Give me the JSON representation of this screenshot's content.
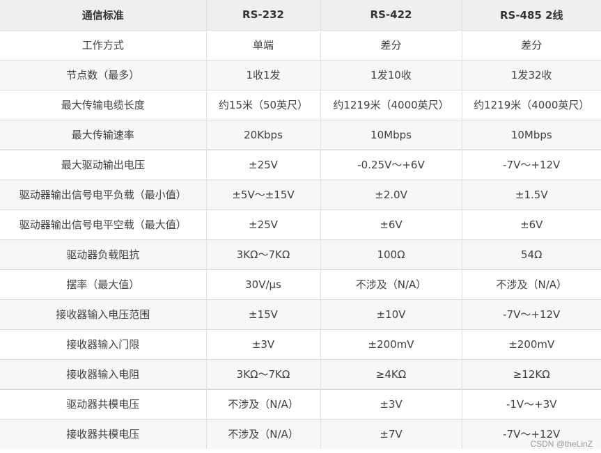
{
  "table": {
    "headers": [
      "通信标准",
      "RS-232",
      "RS-422",
      "RS-485 2线"
    ],
    "rows": [
      [
        "工作方式",
        "单端",
        "差分",
        "差分"
      ],
      [
        "节点数（最多）",
        "1收1发",
        "1发10收",
        "1发32收"
      ],
      [
        "最大传输电缆长度",
        "约15米（50英尺）",
        "约1219米（4000英尺）",
        "约1219米（4000英尺）"
      ],
      [
        "最大传输速率",
        "20Kbps",
        "10Mbps",
        "10Mbps"
      ],
      [
        "最大驱动输出电压",
        "±25V",
        "-0.25V～+6V",
        "-7V～+12V"
      ],
      [
        "驱动器输出信号电平负载（最小值）",
        "±5V～±15V",
        "±2.0V",
        "±1.5V"
      ],
      [
        "驱动器输出信号电平空载（最大值）",
        "±25V",
        "±6V",
        "±6V"
      ],
      [
        "驱动器负载阻抗",
        "3KΩ～7KΩ",
        "100Ω",
        "54Ω"
      ],
      [
        "摆率（最大值）",
        "30V/μs",
        "不涉及（N/A）",
        "不涉及（N/A）"
      ],
      [
        "接收器输入电压范围",
        "±15V",
        "±10V",
        "-7V～+12V"
      ],
      [
        "接收器输入门限",
        "±3V",
        "±200mV",
        "±200mV"
      ],
      [
        "接收器输入电阻",
        "3KΩ～7KΩ",
        "≥4KΩ",
        "≥12KΩ"
      ],
      [
        "驱动器共模电压",
        "不涉及（N/A）",
        "±3V",
        "-1V～+3V"
      ],
      [
        "接收器共模电压",
        "不涉及（N/A）",
        "±7V",
        "-7V～+12V"
      ]
    ]
  },
  "watermark": "CSDN @theLinZ"
}
